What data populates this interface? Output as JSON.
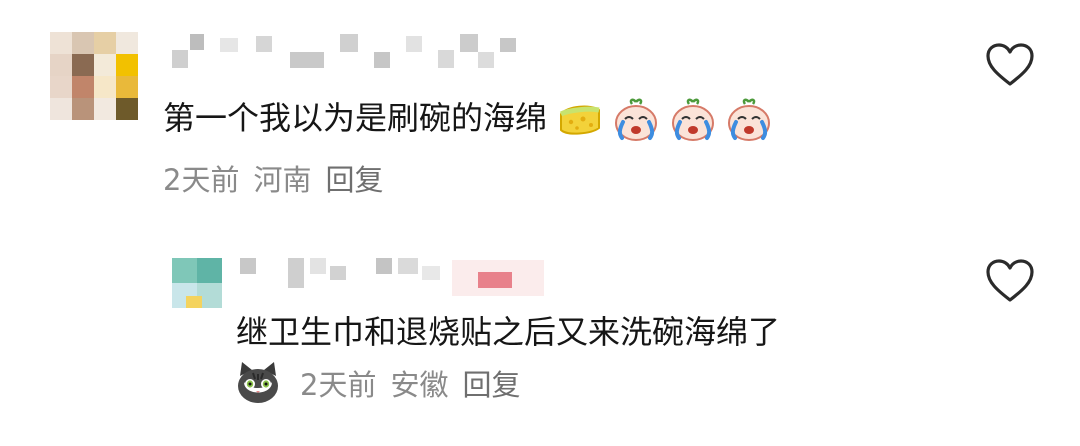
{
  "comments": [
    {
      "text": "第一个我以为是刷碗的海绵",
      "emojis": [
        "sponge-emoji",
        "crying-face-emoji",
        "crying-face-emoji",
        "crying-face-emoji"
      ],
      "time": "2天前",
      "location": "河南",
      "reply_label": "回复"
    },
    {
      "text": "继卫生巾和退烧贴之后又来洗碗海绵了",
      "time": "2天前",
      "location": "安徽",
      "reply_label": "回复"
    }
  ],
  "icons": {
    "like": "heart-outline-icon",
    "commenter_badge": "cat-face-icon"
  },
  "colors": {
    "meta_text": "#8a8a8a",
    "heart_stroke": "#2b2b2b"
  }
}
